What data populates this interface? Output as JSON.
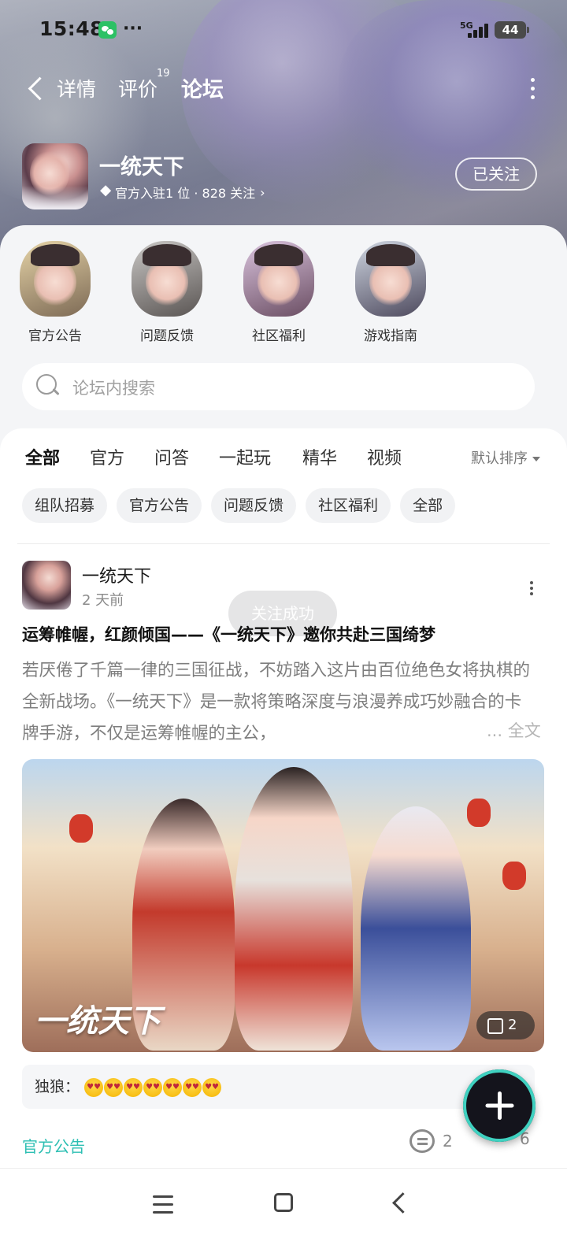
{
  "status_bar": {
    "time": "15:48",
    "network": "5G",
    "battery": "44"
  },
  "nav": {
    "tabs": [
      {
        "label": "详情",
        "active": false
      },
      {
        "label": "评价",
        "active": false,
        "badge": "19"
      },
      {
        "label": "论坛",
        "active": true
      }
    ]
  },
  "game": {
    "name": "一统天下",
    "meta": "官方入驻1 位 · 828 关注",
    "follow_label": "已关注"
  },
  "boards": [
    {
      "label": "官方公告"
    },
    {
      "label": "问题反馈"
    },
    {
      "label": "社区福利"
    },
    {
      "label": "游戏指南"
    }
  ],
  "search": {
    "placeholder": "论坛内搜索"
  },
  "feed_tabs": [
    {
      "label": "全部",
      "active": true
    },
    {
      "label": "官方"
    },
    {
      "label": "问答"
    },
    {
      "label": "一起玩"
    },
    {
      "label": "精华"
    },
    {
      "label": "视频"
    }
  ],
  "sort_label": "默认排序",
  "chips": [
    "组队招募",
    "官方公告",
    "问题反馈",
    "社区福利",
    "全部"
  ],
  "post": {
    "author": "一统天下",
    "time": "2 天前",
    "toast": "关注成功",
    "title": "运筹帷幄，红颜倾国——《一统天下》邀你共赴三国绮梦",
    "body": "若厌倦了千篇一律的三国征战，不妨踏入这片由百位绝色女将执棋的全新战场。《一统天下》是一款将策略深度与浪漫养成巧妙融合的卡牌手游，不仅是运筹帷幄的主公，",
    "full_text": "... 全文",
    "image_logo": "一统天下",
    "image_count": "2",
    "comment_user": "独狼：",
    "comment_emoji_count": 7,
    "tag": "官方公告",
    "comments": "2",
    "likes": "6"
  },
  "icons": [
    "back-icon",
    "more-icon",
    "wechat-icon",
    "signal-icon",
    "battery-icon",
    "diamond-icon",
    "search-icon",
    "image-icon",
    "comment-icon",
    "plus-icon",
    "menu-icon",
    "home-icon"
  ],
  "colors": {
    "accent": "#1ecbc0",
    "tag": "#2dbfb3"
  }
}
